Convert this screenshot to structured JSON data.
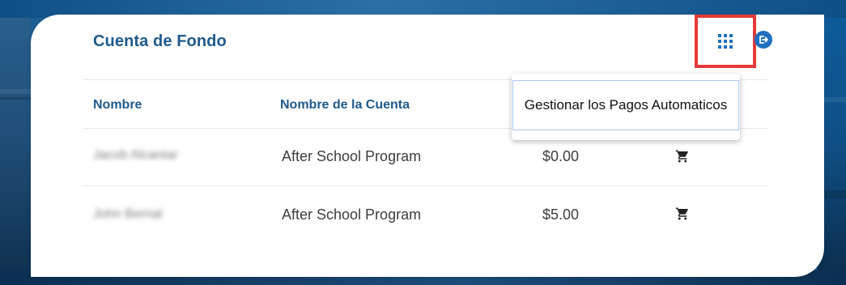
{
  "card": {
    "title": "Cuenta de Fondo"
  },
  "toolbar": {
    "apps_icon": "apps-grid-icon",
    "signout_icon": "sign-out-icon",
    "highlight_color": "#e53a3a",
    "accent_color": "#1f6fbf"
  },
  "dropdown": {
    "items": [
      {
        "label": "Gestionar los Pagos Automaticos"
      }
    ]
  },
  "table": {
    "headers": [
      "Nombre",
      "Nombre de la Cuenta"
    ],
    "rows": [
      {
        "name": "Jacob Alcantar",
        "account": "After School Program",
        "balance": "$0.00",
        "action_icon": "cart-icon"
      },
      {
        "name": "John Bernal",
        "account": "After School Program",
        "balance": "$5.00",
        "action_icon": "cart-icon"
      }
    ]
  }
}
